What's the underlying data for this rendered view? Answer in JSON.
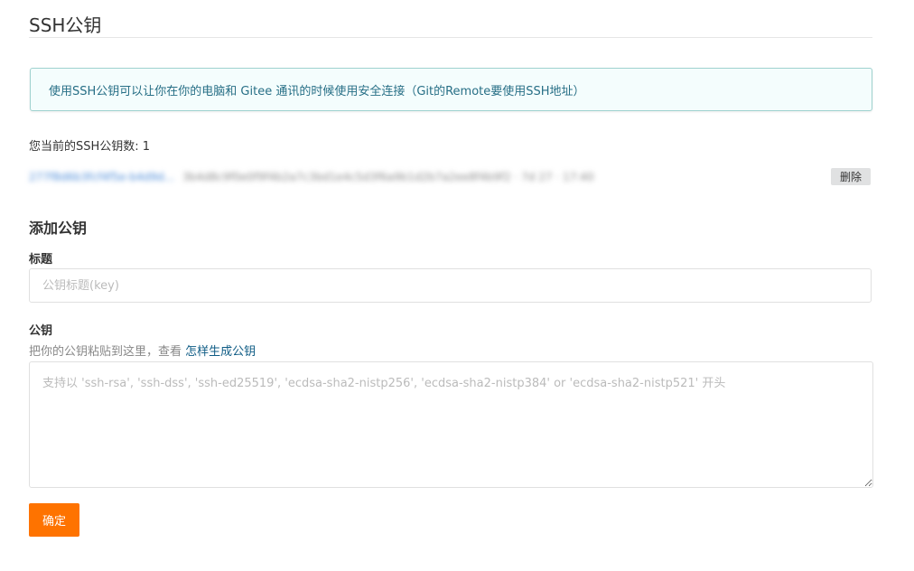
{
  "page": {
    "title": "SSH公钥"
  },
  "info": {
    "text": "使用SSH公钥可以让你在你的电脑和 Gitee 通讯的时候使用安全连接（Git的Remote要使用SSH地址）"
  },
  "keys": {
    "count_label": "您当前的SSH公钥数: 1",
    "items": [
      {
        "title": "277f8d6b3fcf4f5e-b4d9d...",
        "fingerprint": "3b4d8c9f0e0f9f4b2a7c3bd1e4c5d3f6a9b1d2b7a2ee8f4b9f2 · 7d 27 · 17:40",
        "delete_label": "删除"
      }
    ]
  },
  "add_key": {
    "heading": "添加公钥",
    "title_label": "标题",
    "title_placeholder": "公钥标题(key)",
    "key_label": "公钥",
    "hint_text": "把你的公钥粘贴到这里，查看 ",
    "hint_link": "怎样生成公钥",
    "key_placeholder": "支持以 'ssh-rsa', 'ssh-dss', 'ssh-ed25519', 'ecdsa-sha2-nistp256', 'ecdsa-sha2-nistp384' or 'ecdsa-sha2-nistp521' 开头",
    "submit_label": "确定"
  },
  "colors": {
    "accent": "#fe7300",
    "info_border": "#9fd2cf",
    "info_background": "#f4fdfd",
    "info_text": "#276f86",
    "link": "#0f5c85"
  }
}
